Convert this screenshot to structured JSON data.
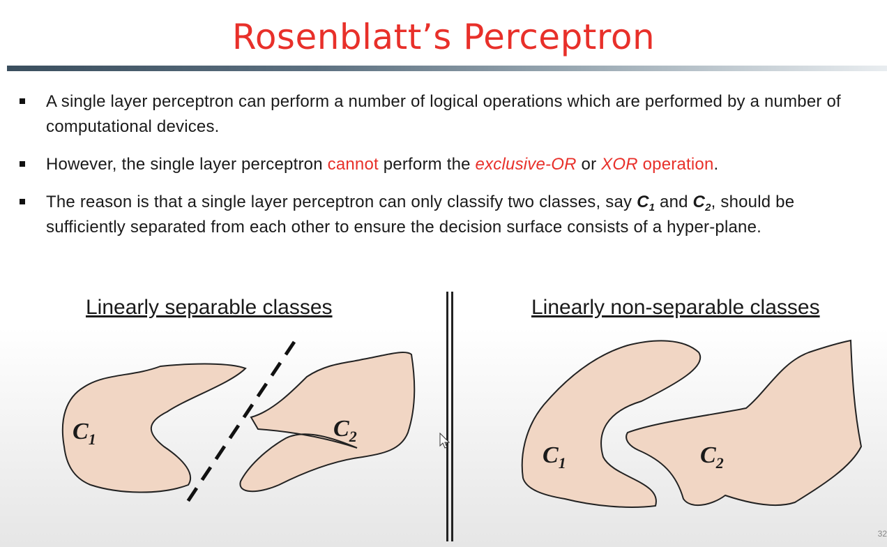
{
  "slide": {
    "title": "Rosenblatt’s Perceptron",
    "accent_color": "#e8302a",
    "page_number": "32"
  },
  "bullets": [
    {
      "text": "A single layer perceptron can perform a number of logical operations which are performed by a number of computational devices."
    },
    {
      "part1": "However, the single layer perceptron ",
      "red1": "cannot",
      "part2": " perform the ",
      "red_italic": "exclusive-OR",
      "part3": " or ",
      "red_italic2": "XOR",
      "red2": " operation",
      "part4": "."
    },
    {
      "part1": "The reason is that a single layer perceptron can only classify two classes, say ",
      "c1": "C",
      "c1_sub": "1",
      "part2": " and ",
      "c2": "C",
      "c2_sub": "2",
      "part3": ", should be sufficiently separated from each other to ensure the decision surface consists of a hyper-plane."
    }
  ],
  "diagrams": {
    "left": {
      "caption": "Linearly separable classes",
      "class1": "C",
      "class1_sub": "1",
      "class2": "C",
      "class2_sub": "2"
    },
    "right": {
      "caption": "Linearly non-separable classes",
      "class1": "C",
      "class1_sub": "1",
      "class2": "C",
      "class2_sub": "2"
    }
  }
}
